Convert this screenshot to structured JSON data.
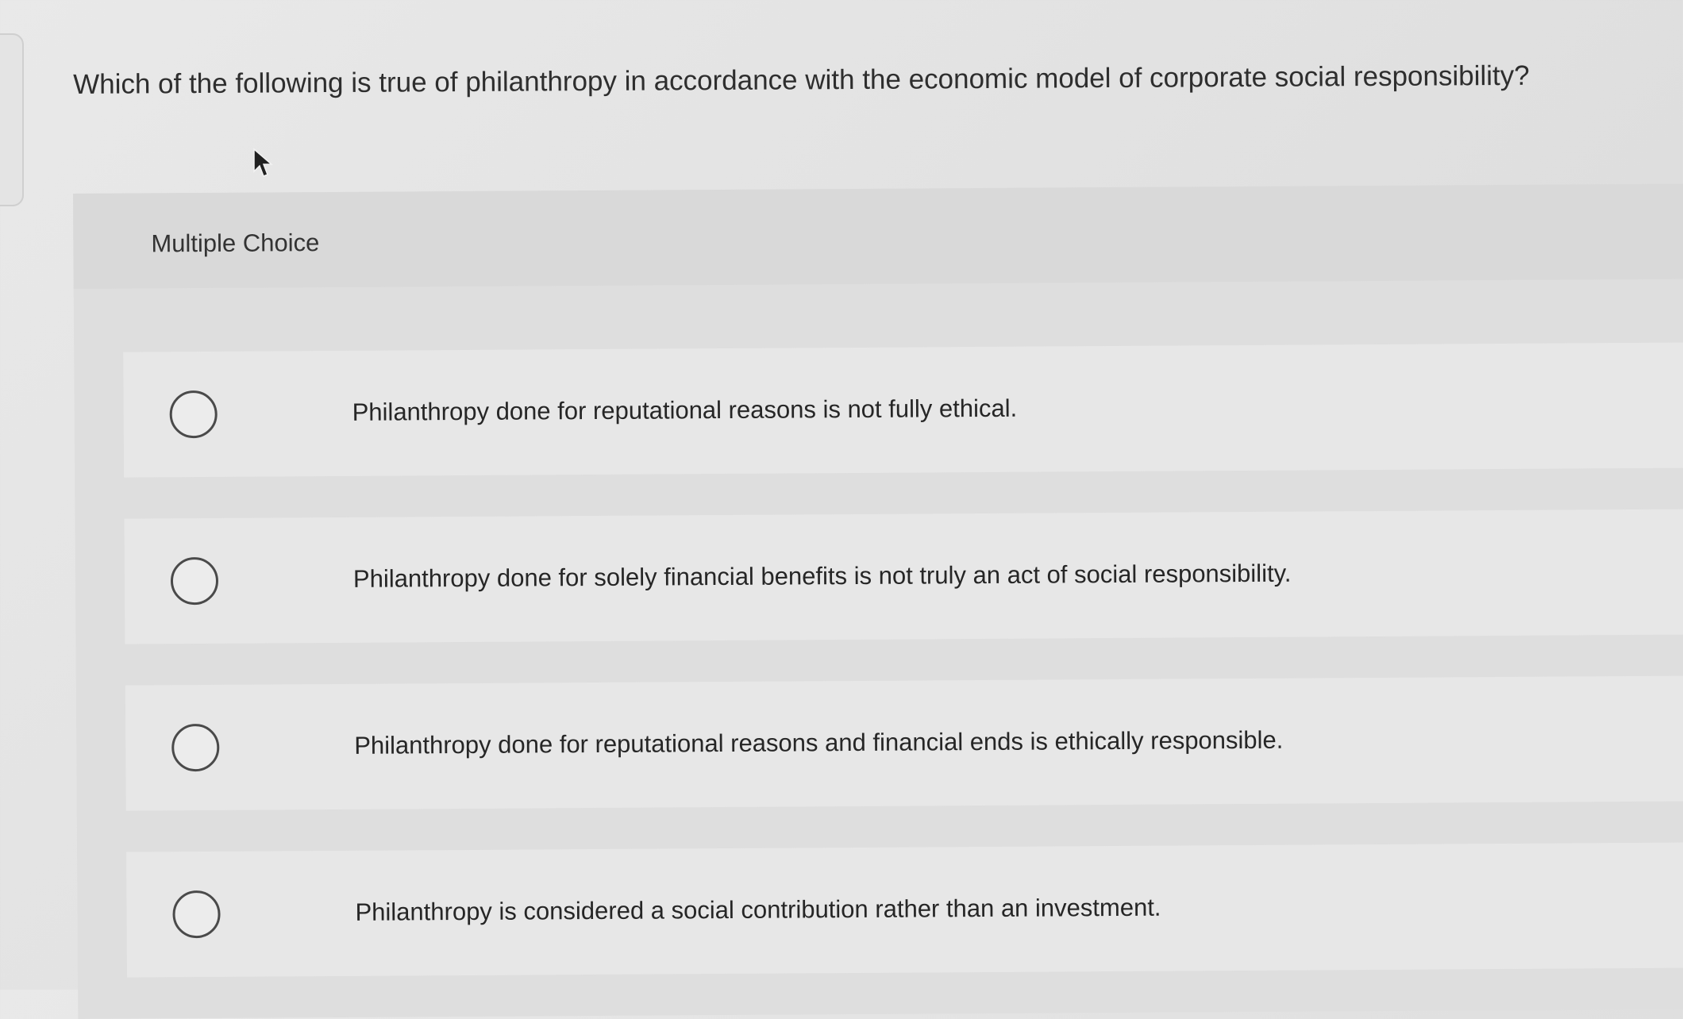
{
  "question": {
    "text": "Which of the following is true of philanthropy in accordance with the economic model of corporate social responsibility?"
  },
  "multiple_choice": {
    "label": "Multiple Choice",
    "options": [
      {
        "text": "Philanthropy done for reputational reasons is not fully ethical.",
        "selected": false
      },
      {
        "text": "Philanthropy done for solely financial benefits is not truly an act of social responsibility.",
        "selected": false
      },
      {
        "text": "Philanthropy done for reputational reasons and financial ends is ethically responsible.",
        "selected": false
      },
      {
        "text": "Philanthropy is considered a social contribution rather than an investment.",
        "selected": false
      }
    ]
  },
  "icons": {
    "cursor": "mouse-pointer-icon",
    "radio": "radio-unchecked-icon"
  }
}
